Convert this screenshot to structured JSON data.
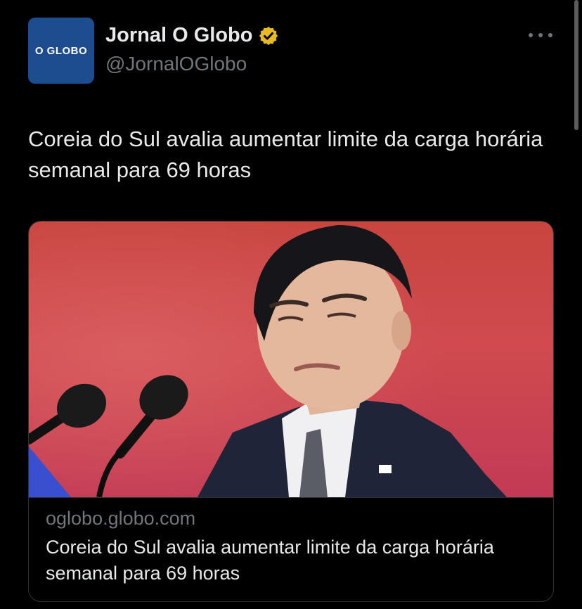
{
  "author": {
    "avatar_text": "O GLOBO",
    "display_name": "Jornal O Globo",
    "handle": "@JornalOGlobo",
    "verified_icon": "verified-badge-gold"
  },
  "tweet": {
    "text": "Coreia do Sul avalia aumentar limite da carga horária semanal para 69 horas"
  },
  "link_card": {
    "domain": "oglobo.globo.com",
    "title": "Coreia do Sul avalia aumentar limite da carga horária semanal para 69 horas"
  },
  "colors": {
    "background": "#000000",
    "avatar_bg": "#1e4d8f",
    "verified": "#e8b923",
    "secondary_text": "#71767b"
  }
}
